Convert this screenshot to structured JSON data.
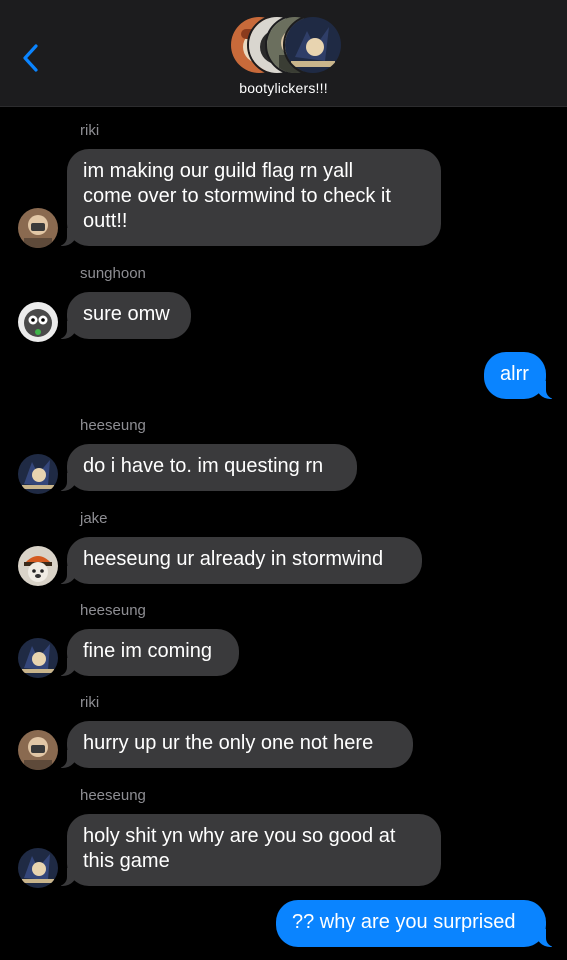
{
  "header": {
    "group_name": "bootylickers!!!",
    "back_icon": "chevron-left-icon",
    "accent_color": "#0a84ff"
  },
  "messages": [
    {
      "sender": "riki",
      "text": "im making our guild flag rn yall\ncome over to stormwind to check it\noutt!!",
      "direction": "incoming"
    },
    {
      "sender": "sunghoon",
      "text": "sure omw",
      "direction": "incoming"
    },
    {
      "sender": "",
      "text": "alrr",
      "direction": "outgoing"
    },
    {
      "sender": "heeseung",
      "text": "do i have to. im questing rn",
      "direction": "incoming"
    },
    {
      "sender": "jake",
      "text": "heeseung ur already in stormwind",
      "direction": "incoming"
    },
    {
      "sender": "heeseung",
      "text": "fine im coming",
      "direction": "incoming"
    },
    {
      "sender": "riki",
      "text": "hurry up ur the only one not here",
      "direction": "incoming"
    },
    {
      "sender": "heeseung",
      "text": "holy shit yn why are you so good at\nthis game",
      "direction": "incoming"
    },
    {
      "sender": "",
      "text": "?? why are you surprised",
      "direction": "outgoing"
    }
  ],
  "colors": {
    "incoming_bubble": "#3a3a3c",
    "outgoing_bubble": "#0a84ff",
    "sender_label": "#8e8e93",
    "background": "#000000"
  }
}
